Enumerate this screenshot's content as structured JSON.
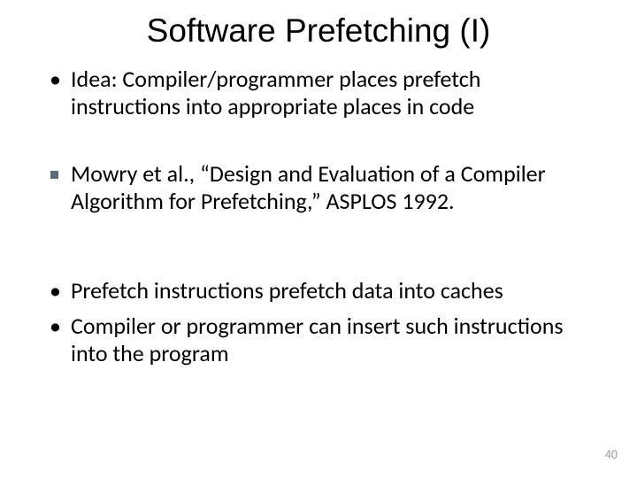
{
  "title": "Software Prefetching (I)",
  "bullets": {
    "b1": "Idea: Compiler/programmer places prefetch instructions into appropriate places in code",
    "b2_pre": "Mowry et al., ",
    "b2_quote_open": "“",
    "b2_title": "Design and Evaluation of a Compiler Algorithm for Prefetching,",
    "b2_quote_close": "”",
    "b2_post": " ASPLOS 1992.",
    "b3": "Prefetch instructions prefetch data into caches",
    "b4": "Compiler or programmer can insert such instructions into the program"
  },
  "page_number": "40"
}
